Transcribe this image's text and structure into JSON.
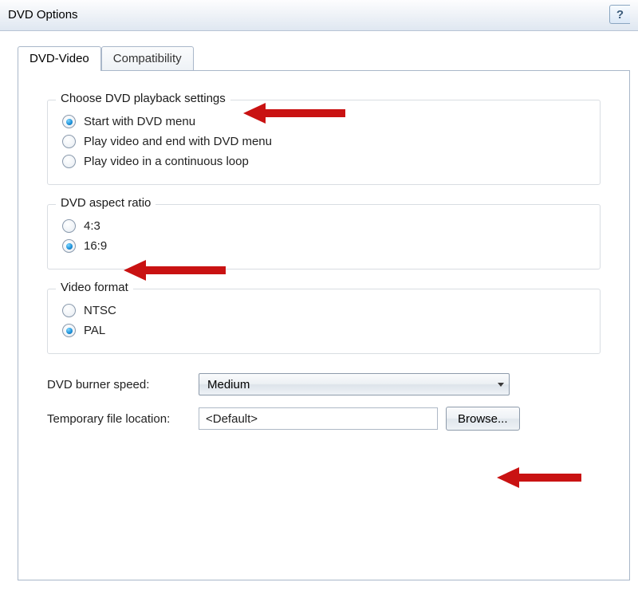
{
  "window": {
    "title": "DVD Options",
    "help_glyph": "?"
  },
  "tabs": [
    {
      "label": "DVD-Video",
      "active": true
    },
    {
      "label": "Compatibility",
      "active": false
    }
  ],
  "playback": {
    "legend": "Choose DVD playback settings",
    "options": [
      {
        "label": "Start with DVD menu",
        "selected": true
      },
      {
        "label": "Play video and end with DVD menu",
        "selected": false
      },
      {
        "label": "Play video in a continuous loop",
        "selected": false
      }
    ]
  },
  "aspect": {
    "legend": "DVD aspect ratio",
    "options": [
      {
        "label": "4:3",
        "selected": false
      },
      {
        "label": "16:9",
        "selected": true
      }
    ]
  },
  "vformat": {
    "legend": "Video format",
    "options": [
      {
        "label": "NTSC",
        "selected": false
      },
      {
        "label": "PAL",
        "selected": true
      }
    ]
  },
  "burner": {
    "label": "DVD burner speed:",
    "value": "Medium"
  },
  "temp": {
    "label": "Temporary file location:",
    "value": "<Default>",
    "browse_label": "Browse..."
  }
}
